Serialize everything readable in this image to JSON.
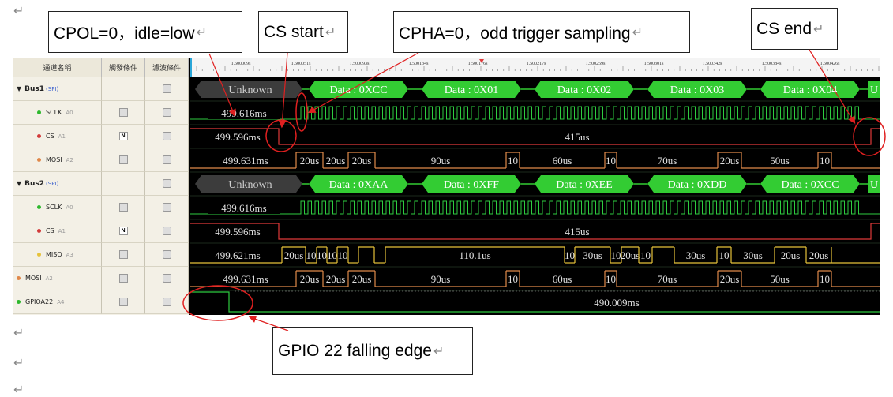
{
  "callouts": {
    "cpol": "CPOL=0，idle=low",
    "cs_start": "CS start",
    "cpha": "CPHA=0，odd trigger sampling",
    "cs_end": "CS end",
    "gpio": "GPIO 22 falling edge"
  },
  "return_mark": "↵",
  "table_header": {
    "channel": "通道名稱",
    "trigger": "觸發條件",
    "filter": "濾波條件"
  },
  "channels": [
    {
      "label": "Bus1",
      "sub": "(SPI)",
      "type": "bus"
    },
    {
      "label": "SCLK",
      "pin": "A0",
      "dot": "#2db82d"
    },
    {
      "label": "CS",
      "pin": "A1",
      "dot": "#d23a3a",
      "trigger_icon": "N"
    },
    {
      "label": "MOSI",
      "pin": "A2",
      "dot": "#e0884a"
    },
    {
      "label": "Bus2",
      "sub": "(SPI)",
      "type": "bus"
    },
    {
      "label": "SCLK",
      "pin": "A0",
      "dot": "#2db82d"
    },
    {
      "label": "CS",
      "pin": "A1",
      "dot": "#d23a3a",
      "trigger_icon": "N"
    },
    {
      "label": "MISO",
      "pin": "A3",
      "dot": "#e6c23a"
    },
    {
      "label": "MOSI",
      "pin": "A2",
      "dot": "#e0884a"
    },
    {
      "label": "GPIOA22",
      "pin": "A4",
      "dot": "#2db82d"
    }
  ],
  "timeline_ticks": [
    "1.500009s",
    "1.500051s",
    "1.500093s",
    "1.500134s",
    "1.500176s",
    "1.500217s",
    "1.500259s",
    "1.500301s",
    "1.500342s",
    "1.500384s",
    "1.500426s"
  ],
  "bus1": {
    "unknown": "Unknown",
    "frames": [
      "Data : 0XCC",
      "Data : 0X01",
      "Data : 0X02",
      "Data : 0X03",
      "Data : 0X04"
    ],
    "tail": "U"
  },
  "bus2": {
    "unknown": "Unknown",
    "frames": [
      "Data : 0XAA",
      "Data : 0XFF",
      "Data : 0XEE",
      "Data : 0XDD",
      "Data : 0XCC"
    ],
    "tail": "U"
  },
  "sclk_time": "499.616ms",
  "cs_time": "499.596ms",
  "cs_width": "415us",
  "mosi": {
    "time": "499.631ms",
    "widths": [
      "20us",
      "20us",
      "20us",
      "90us",
      "10",
      "60us",
      "10",
      "70us",
      "20us",
      "50us",
      "10"
    ]
  },
  "miso": {
    "time": "499.621ms",
    "widths": [
      "20us",
      "10",
      "10",
      "10",
      "10",
      "110.1us",
      "10",
      "30us",
      "10",
      "20us",
      "10",
      "30us",
      "10",
      "30us",
      "20us",
      "20us"
    ]
  },
  "gpio_width": "490.009ms",
  "colors": {
    "bus_green": "#33cc33",
    "sclk_green": "#2ecc40",
    "cs_red": "#e03a3a",
    "mosi_orange": "#e08a4a",
    "miso_yellow": "#e6c23a",
    "annot_red": "#e02020"
  }
}
